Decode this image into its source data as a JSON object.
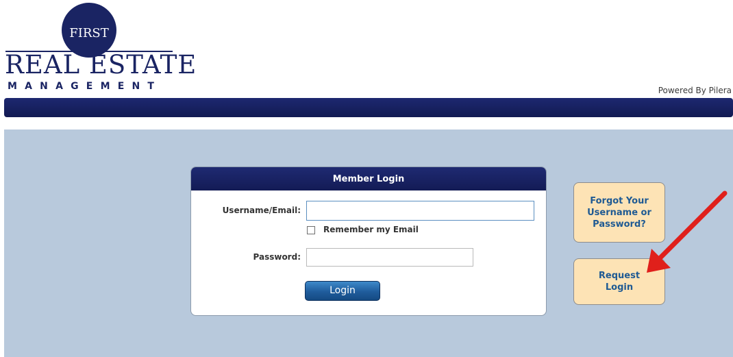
{
  "logo": {
    "circle_word": "FIRST",
    "name": "REAL ESTATE",
    "sub": "MANAGEMENT"
  },
  "header": {
    "powered_by": "Powered By Pilera"
  },
  "login": {
    "title": "Member Login",
    "username_label": "Username/Email:",
    "username_value": "",
    "remember_label": "Remember my Email",
    "remember_checked": false,
    "password_label": "Password:",
    "password_value": "",
    "login_button": "Login"
  },
  "side": {
    "forgot_lines": [
      "Forgot Your",
      "Username or",
      "Password?"
    ],
    "request_lines": [
      "Request",
      "Login"
    ]
  },
  "colors": {
    "brand_navy": "#1a2463",
    "main_background": "#b8c9dc",
    "side_button_bg": "#fde3b5",
    "side_button_text": "#1f5a93",
    "annotation_arrow": "#e0201b"
  },
  "annotation": {
    "icon": "red-arrow-icon",
    "points_to": "request-login-button"
  }
}
